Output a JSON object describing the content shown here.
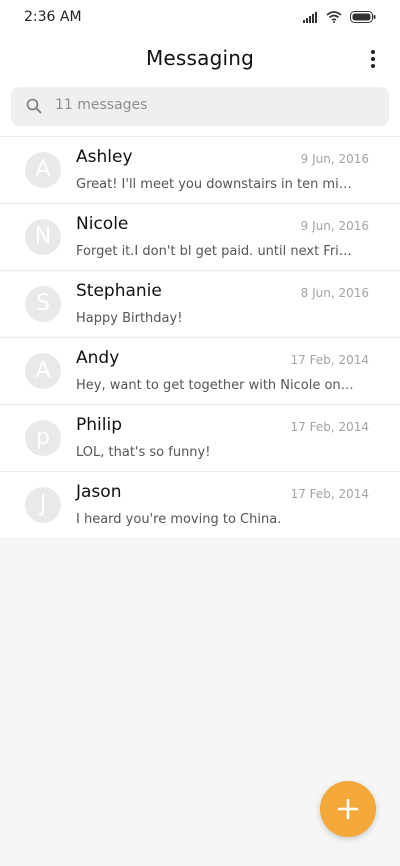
{
  "status_bar": {
    "time": "2:36 AM",
    "icons": [
      "signal-icon",
      "wifi-icon",
      "battery-icon"
    ]
  },
  "header": {
    "title": "Messaging",
    "menu_icon": "more-vertical-icon"
  },
  "search": {
    "icon": "search-icon",
    "placeholder": "11 messages"
  },
  "conversations": [
    {
      "initial": "A",
      "name": "Ashley",
      "date": "9 Jun, 2016",
      "preview": "Great! I'll meet you downstairs in ten minu..."
    },
    {
      "initial": "N",
      "name": "Nicole",
      "date": "9 Jun, 2016",
      "preview": "Forget it.I don't bl get paid. until next Frid..."
    },
    {
      "initial": "S",
      "name": "Stephanie",
      "date": "8 Jun, 2016",
      "preview": "Happy Birthday!"
    },
    {
      "initial": "A",
      "name": "Andy",
      "date": "17 Feb, 2014",
      "preview": "Hey, want to get together with Nicole on ..."
    },
    {
      "initial": "p",
      "name": "Philip",
      "date": "17 Feb, 2014",
      "preview": "LOL, that's so funny!"
    },
    {
      "initial": "J",
      "name": "Jason",
      "date": "17 Feb, 2014",
      "preview": "I heard you're moving to China."
    }
  ],
  "fab": {
    "icon": "plus-icon",
    "color": "#f5a83a"
  }
}
